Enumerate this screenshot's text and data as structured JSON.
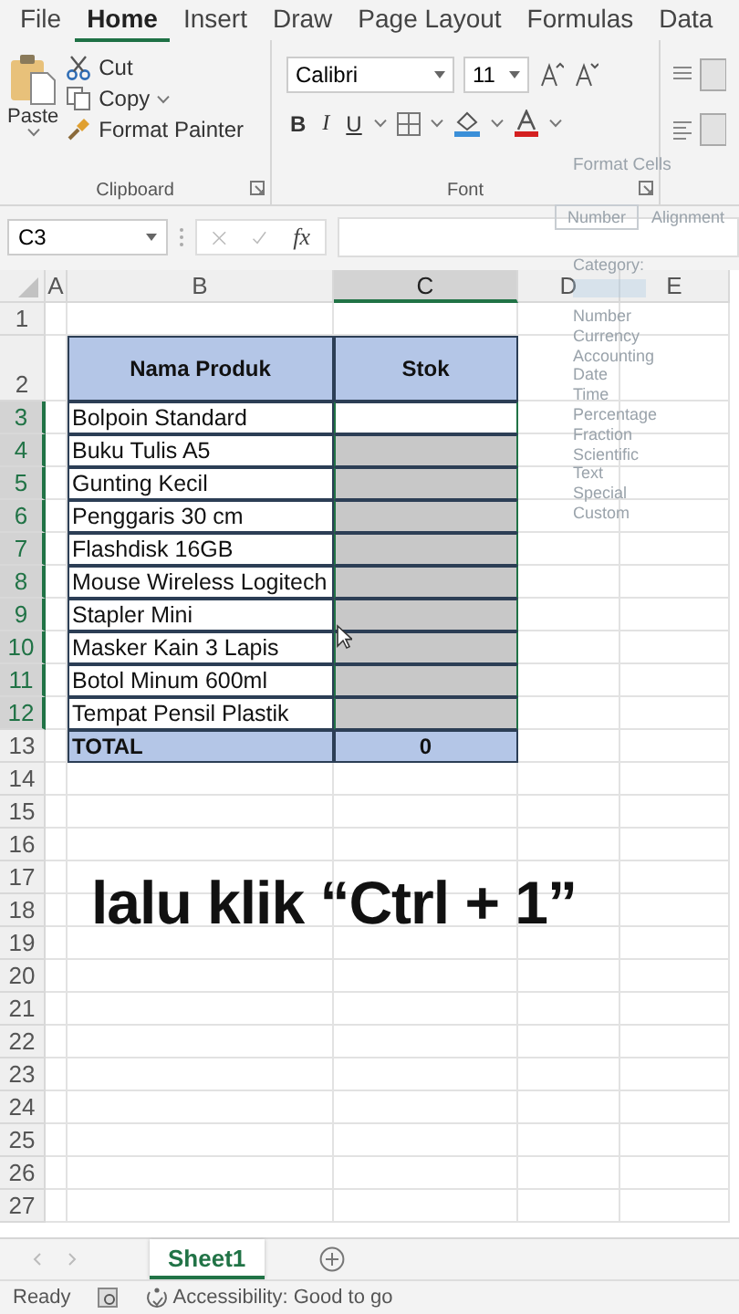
{
  "menu_tabs": [
    {
      "label": "File",
      "selected": false
    },
    {
      "label": "Home",
      "selected": true
    },
    {
      "label": "Insert",
      "selected": false
    },
    {
      "label": "Draw",
      "selected": false
    },
    {
      "label": "Page Layout",
      "selected": false
    },
    {
      "label": "Formulas",
      "selected": false
    },
    {
      "label": "Data",
      "selected": false
    }
  ],
  "clipboard": {
    "paste": "Paste",
    "cut": "Cut",
    "copy": "Copy",
    "format_painter": "Format Painter",
    "group": "Clipboard"
  },
  "font": {
    "name": "Calibri",
    "size": "11",
    "bold": "B",
    "italic": "I",
    "underline": "U",
    "group": "Font"
  },
  "formula_bar": {
    "name_box": "C3",
    "fx": "fx"
  },
  "sheet": {
    "columns": [
      {
        "label": "A",
        "selected": false
      },
      {
        "label": "B",
        "selected": false
      },
      {
        "label": "C",
        "selected": true
      },
      {
        "label": "D",
        "selected": false
      },
      {
        "label": "E",
        "selected": false
      }
    ],
    "rows": [
      {
        "label": "1",
        "selected": false
      },
      {
        "label": "2",
        "selected": false
      },
      {
        "label": "3",
        "selected": true
      },
      {
        "label": "4",
        "selected": true
      },
      {
        "label": "5",
        "selected": true
      },
      {
        "label": "6",
        "selected": true
      },
      {
        "label": "7",
        "selected": true
      },
      {
        "label": "8",
        "selected": true
      },
      {
        "label": "9",
        "selected": true
      },
      {
        "label": "10",
        "selected": true
      },
      {
        "label": "11",
        "selected": true
      },
      {
        "label": "12",
        "selected": true
      },
      {
        "label": "13",
        "selected": false
      },
      {
        "label": "14",
        "selected": false
      },
      {
        "label": "15",
        "selected": false
      },
      {
        "label": "16",
        "selected": false
      },
      {
        "label": "17",
        "selected": false
      },
      {
        "label": "18",
        "selected": false
      },
      {
        "label": "19",
        "selected": false
      },
      {
        "label": "20",
        "selected": false
      },
      {
        "label": "21",
        "selected": false
      },
      {
        "label": "22",
        "selected": false
      },
      {
        "label": "23",
        "selected": false
      },
      {
        "label": "24",
        "selected": false
      },
      {
        "label": "25",
        "selected": false
      },
      {
        "label": "26",
        "selected": false
      },
      {
        "label": "27",
        "selected": false
      }
    ]
  },
  "table": {
    "columns": [
      "Nama Produk",
      "Stok"
    ],
    "rows": [
      {
        "product": "Bolpoin Standard",
        "selected": false
      },
      {
        "product": "Buku Tulis A5",
        "selected": true
      },
      {
        "product": "Gunting Kecil",
        "selected": true
      },
      {
        "product": "Penggaris 30 cm",
        "selected": true
      },
      {
        "product": "Flashdisk 16GB",
        "selected": true
      },
      {
        "product": "Mouse Wireless Logitech",
        "selected": true
      },
      {
        "product": "Stapler Mini",
        "selected": true
      },
      {
        "product": "Masker Kain 3 Lapis",
        "selected": true
      },
      {
        "product": "Botol Minum 600ml",
        "selected": true
      },
      {
        "product": "Tempat Pensil Plastik",
        "selected": true
      }
    ],
    "total": {
      "label": "TOTAL",
      "value": "0"
    }
  },
  "dialog": {
    "title": "Format Cells",
    "tabs": [
      {
        "label": "Number",
        "selected": true
      },
      {
        "label": "Alignment",
        "selected": false
      }
    ],
    "category_label": "Category:",
    "categories": [
      "Number",
      "Currency",
      "Accounting",
      "Date",
      "Time",
      "Percentage",
      "Fraction",
      "Scientific",
      "Text",
      "Special",
      "Custom"
    ]
  },
  "caption": "lalu klik “Ctrl + 1”",
  "sheet_tabs": [
    {
      "label": "Sheet1",
      "selected": true
    }
  ],
  "status": {
    "ready": "Ready",
    "accessibility": "Accessibility: Good to go"
  }
}
